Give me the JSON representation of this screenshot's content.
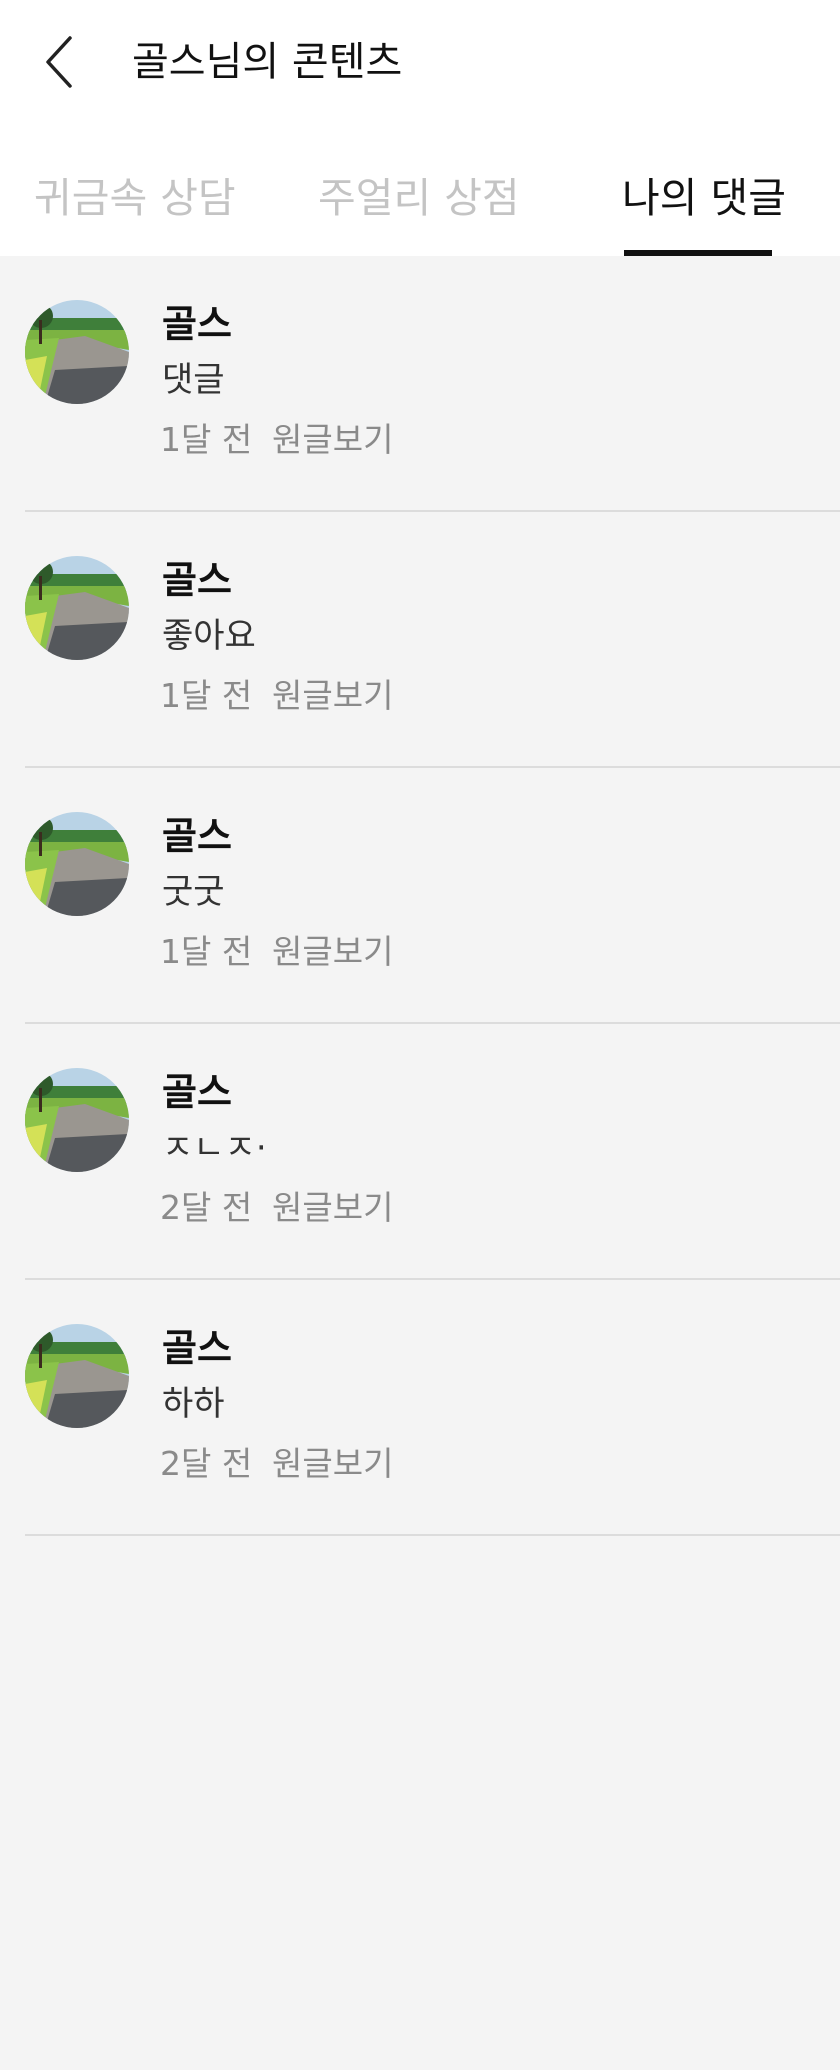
{
  "header": {
    "title": "골스님의 콘텐츠",
    "back_icon": "chevron-left-icon"
  },
  "tabs": [
    {
      "label": "귀금속 상담",
      "active": false
    },
    {
      "label": "주얼리 상점",
      "active": false
    },
    {
      "label": "나의 댓글",
      "active": true
    }
  ],
  "comments": [
    {
      "author": "골스",
      "text": "댓글",
      "time": "1달 전",
      "link": "원글보기"
    },
    {
      "author": "골스",
      "text": "좋아요",
      "time": "1달 전",
      "link": "원글보기"
    },
    {
      "author": "골스",
      "text": "굿굿",
      "time": "1달 전",
      "link": "원글보기"
    },
    {
      "author": "골스",
      "text": "ㅈㄴㅈ·",
      "time": "2달 전",
      "link": "원글보기"
    },
    {
      "author": "골스",
      "text": "하하",
      "time": "2달 전",
      "link": "원글보기"
    }
  ],
  "colors": {
    "background": "#f4f4f4",
    "header_background": "#ffffff",
    "active_tab": "#111111",
    "inactive_tab": "#c4c4c4",
    "meta_text": "#8a8a8a",
    "divider": "#dcdcdc"
  }
}
